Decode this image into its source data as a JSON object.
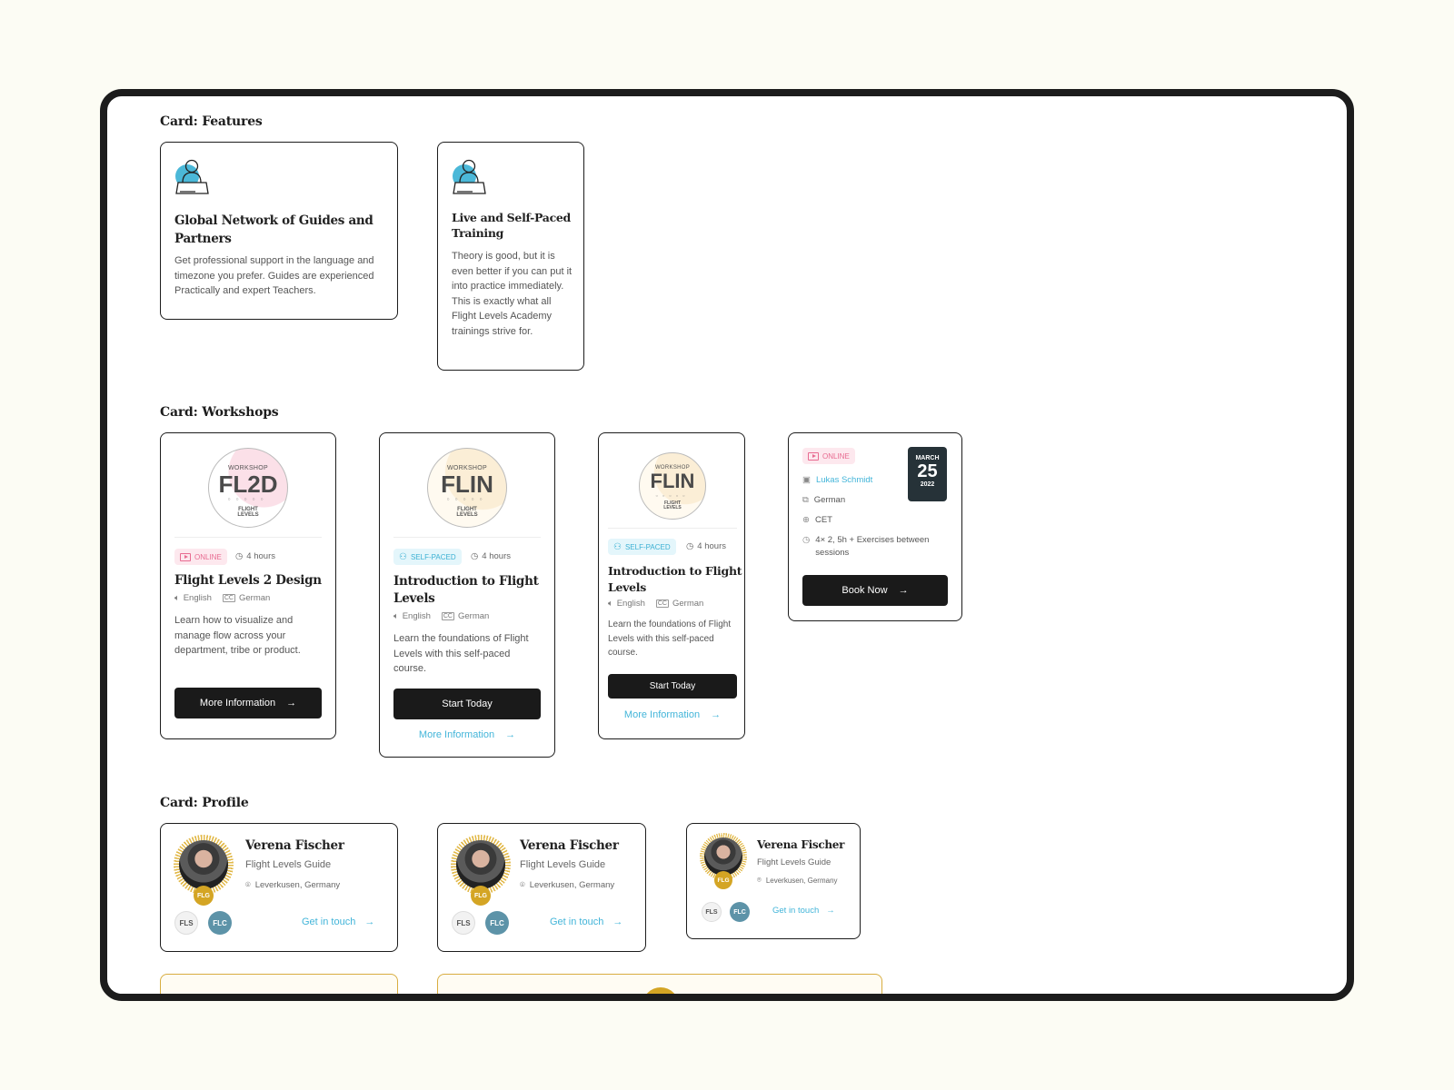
{
  "sections": {
    "features": "Card: Features",
    "workshops": "Card: Workshops",
    "profile": "Card: Profile"
  },
  "features": [
    {
      "icon": "person-laptop-icon",
      "title_l1": "Global Network of Guides and",
      "title_l2": "Partners",
      "body": "Get professional support in the language and timezone you prefer. Guides are experienced Practically and expert Teachers."
    },
    {
      "icon": "person-laptop-icon",
      "title_l1": "Live and Self-Paced",
      "title_l2": "Training",
      "body": "Theory is good, but it is even better if you can put it into practice immediately. This is exactly what all Flight Levels Academy trainings strive for."
    }
  ],
  "workshops": [
    {
      "logo_kicker": "WORKSHOP",
      "logo_code": "FL2D",
      "logo_dots": "○○○○○",
      "logo_brand_l1": "FLIGHT",
      "logo_brand_l2": "LEVELS",
      "badge": "ONLINE",
      "duration": "4 hours",
      "title_l1": "Flight Levels 2 Design",
      "title_l2": "",
      "lang_audio": "English",
      "lang_subtitle": "German",
      "description": "Learn how to visualize and manage flow across your department, tribe or product.",
      "primary_button": "More Information"
    },
    {
      "logo_kicker": "WORKSHOP",
      "logo_code": "FLIN",
      "logo_dots": "○○○○○",
      "logo_brand_l1": "FLIGHT",
      "logo_brand_l2": "LEVELS",
      "badge": "SELF-PACED",
      "duration": "4 hours",
      "title_l1": "Introduction to Flight",
      "title_l2": "Levels",
      "lang_audio": "English",
      "lang_subtitle": "German",
      "description": "Learn the foundations of Flight Levels with this self-paced course.",
      "primary_button": "Start Today",
      "secondary_link": "More Information"
    },
    {
      "logo_kicker": "WORKSHOP",
      "logo_code": "FLIN",
      "logo_dots": "○○○○○",
      "logo_brand_l1": "FLIGHT",
      "logo_brand_l2": "LEVELS",
      "badge": "SELF-PACED",
      "duration": "4 hours",
      "title_l1": "Introduction to Flight",
      "title_l2": "Levels",
      "lang_audio": "English",
      "lang_subtitle": "German",
      "description": "Learn the foundations of Flight Levels with this self-paced course.",
      "primary_button": "Start Today",
      "secondary_link": "More Information"
    }
  ],
  "event": {
    "badge": "ONLINE",
    "trainer": "Lukas Schmidt",
    "language": "German",
    "timezone": "CET",
    "schedule": "4× 2, 5h + Exercises between sessions",
    "date_month": "MARCH",
    "date_day": "25",
    "date_year": "2022",
    "button": "Book Now"
  },
  "profiles": [
    {
      "name": "Verena Fischer",
      "role": "Flight Levels Guide",
      "location": "Leverkusen, Germany",
      "badge": "FLG",
      "certs": [
        "FLS",
        "FLC"
      ],
      "link": "Get in touch"
    },
    {
      "name": "Verena Fischer",
      "role": "Flight Levels Guide",
      "location": "Leverkusen, Germany",
      "badge": "FLG",
      "certs": [
        "FLS",
        "FLC"
      ],
      "link": "Get in touch"
    },
    {
      "name": "Verena Fischer",
      "role": "Flight Levels Guide",
      "location": "Leverkusen, Germany",
      "badge": "FLG",
      "certs": [
        "FLS",
        "FLC"
      ],
      "link": "Get in touch"
    }
  ],
  "colors": {
    "online": "#e86b91",
    "self_paced": "#3bb0d3",
    "link": "#43b5d9",
    "gold": "#d4a524",
    "dark": "#1a1a1a"
  }
}
